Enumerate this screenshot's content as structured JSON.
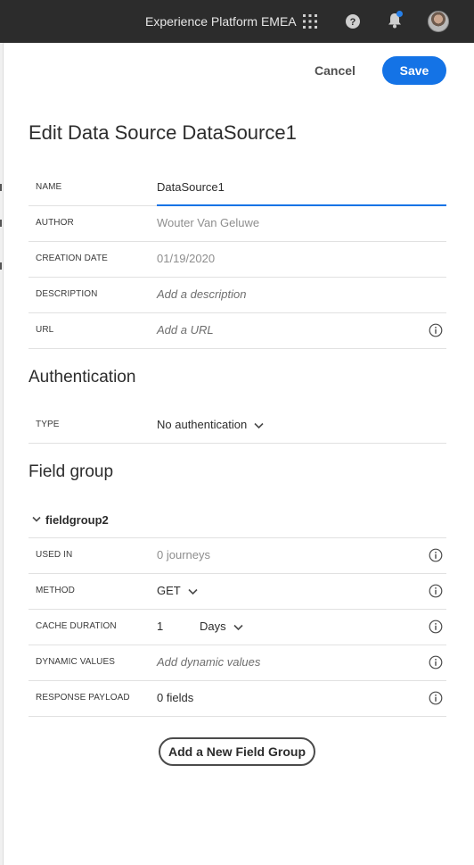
{
  "topbar": {
    "org_name": "Experience Platform EMEA",
    "icons": [
      "apps-grid-icon",
      "help-icon",
      "bell-icon",
      "avatar"
    ],
    "notification_dot_color": "#2680eb"
  },
  "actions": {
    "cancel_label": "Cancel",
    "save_label": "Save",
    "save_color": "#1473e6"
  },
  "page": {
    "title": "Edit Data Source DataSource1"
  },
  "general": {
    "name": {
      "label": "NAME",
      "value": "DataSource1"
    },
    "author": {
      "label": "AUTHOR",
      "value": "Wouter Van Geluwe"
    },
    "creation_date": {
      "label": "CREATION DATE",
      "value": "01/19/2020"
    },
    "description": {
      "label": "DESCRIPTION",
      "placeholder": "Add a description"
    },
    "url": {
      "label": "URL",
      "placeholder": "Add a URL"
    }
  },
  "authentication": {
    "title": "Authentication",
    "type": {
      "label": "TYPE",
      "value": "No authentication"
    }
  },
  "field_group_section": {
    "title": "Field group",
    "group": {
      "name": "fieldgroup2",
      "used_in": {
        "label": "USED IN",
        "value": "0 journeys"
      },
      "method": {
        "label": "METHOD",
        "value": "GET"
      },
      "cache_duration": {
        "label": "CACHE DURATION",
        "value": "1",
        "unit": "Days"
      },
      "dynamic_values": {
        "label": "DYNAMIC VALUES",
        "placeholder": "Add dynamic values"
      },
      "response_payload": {
        "label": "RESPONSE PAYLOAD",
        "value": "0 fields"
      }
    },
    "add_button_label": "Add a New Field Group"
  }
}
